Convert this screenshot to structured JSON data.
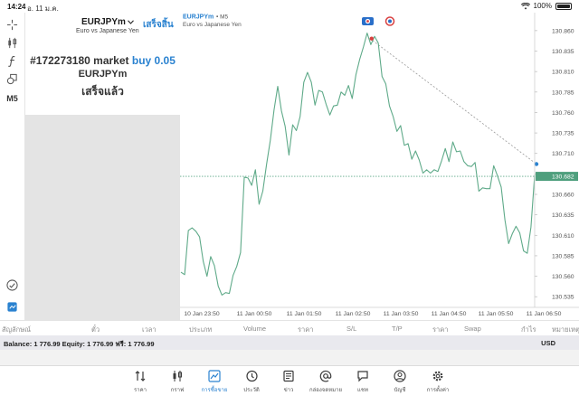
{
  "status_bar": {
    "time": "14:24",
    "date": "อ. 11 ม.ค.",
    "battery": "100%"
  },
  "toolbar": {
    "icons": [
      "crosshair-icon",
      "candles-icon",
      "indicator-f-icon",
      "objects-icon"
    ],
    "timeframe": "M5",
    "bottom_icons": [
      "check-icon",
      "add-chart-icon"
    ]
  },
  "order_panel": {
    "symbol": "EURJPYm",
    "symbol_desc": "Euro vs Japanese Yen",
    "done_label": "เสร็จสิ้น",
    "order_id_text": "#172273180 market",
    "order_type": "buy 0.05",
    "order_symbol": "EURJPYm",
    "order_state": "เสร็จแล้ว"
  },
  "chart": {
    "symbol_label": "EURJPYm",
    "timeframe_label": "M5",
    "description": "Euro vs Japanese Yen",
    "current_price": "130.682",
    "colors": {
      "line": "#5faa89",
      "current_line": "#5faa89",
      "current_bg": "#4e9f7d",
      "marker_red": "#d94040",
      "marker_blue": "#2a82d0"
    }
  },
  "chart_data": {
    "type": "line",
    "x_ticks": [
      "10 Jan 23:50",
      "11 Jan 00:50",
      "11 Jan 01:50",
      "11 Jan 02:50",
      "11 Jan 03:50",
      "11 Jan 04:50",
      "11 Jan 05:50",
      "11 Jan 06:50"
    ],
    "y_ticks": [
      "130.860",
      "130.835",
      "130.810",
      "130.785",
      "130.760",
      "130.735",
      "130.710",
      "130.685",
      "130.660",
      "130.635",
      "130.610",
      "130.585",
      "130.560",
      "130.535"
    ],
    "ylim": [
      130.522,
      130.872
    ],
    "values": [
      130.565,
      130.562,
      130.616,
      130.619,
      130.615,
      130.608,
      130.578,
      130.56,
      130.584,
      130.573,
      130.548,
      130.537,
      130.54,
      130.539,
      130.561,
      130.572,
      130.589,
      130.681,
      130.68,
      130.671,
      130.69,
      130.648,
      130.664,
      130.697,
      130.726,
      130.763,
      130.792,
      130.762,
      130.743,
      130.708,
      130.745,
      130.738,
      130.755,
      130.797,
      130.809,
      130.797,
      130.769,
      130.787,
      130.785,
      130.77,
      130.757,
      130.768,
      130.769,
      130.785,
      130.781,
      130.793,
      130.777,
      130.806,
      130.825,
      130.84,
      130.857,
      130.843,
      130.853,
      130.845,
      130.804,
      130.795,
      130.768,
      130.755,
      130.737,
      130.744,
      130.72,
      130.722,
      130.703,
      130.713,
      130.702,
      130.686,
      130.69,
      130.686,
      130.69,
      130.688,
      130.701,
      130.716,
      130.7,
      130.724,
      130.712,
      130.713,
      130.7,
      130.695,
      130.694,
      130.699,
      130.664,
      130.668,
      130.667,
      130.667,
      130.695,
      130.683,
      130.669,
      130.629,
      130.6,
      130.612,
      130.621,
      130.613,
      130.591,
      130.588,
      130.62,
      130.684
    ],
    "current_price": 130.682,
    "trade_line": {
      "from_price": 130.848,
      "to_price": 130.697
    }
  },
  "positions_header": {
    "columns": [
      "สัญลักษณ์",
      "ตั๋ว",
      "เวลา",
      "ประเภท",
      "Volume",
      "ราคา",
      "S/L",
      "T/P",
      "ราคา",
      "Swap",
      "กำไร",
      "หมายเหตุ"
    ]
  },
  "balance_bar": {
    "text": "Balance: 1 776.99  Equity: 1 776.99  ฟรี: 1 776.99",
    "currency": "USD"
  },
  "tabs": [
    {
      "label": "ราคา",
      "icon": "quotes-icon"
    },
    {
      "label": "กราฟ",
      "icon": "charts-icon"
    },
    {
      "label": "การซื้อขาย",
      "icon": "trade-icon"
    },
    {
      "label": "ประวัติ",
      "icon": "history-icon"
    },
    {
      "label": "ข่าว",
      "icon": "news-icon"
    },
    {
      "label": "กล่องจดหมาย",
      "icon": "mailbox-icon"
    },
    {
      "label": "แชท",
      "icon": "chat-icon"
    },
    {
      "label": "บัญชี",
      "icon": "account-icon"
    },
    {
      "label": "การตั้งค่า",
      "icon": "settings-icon"
    }
  ]
}
